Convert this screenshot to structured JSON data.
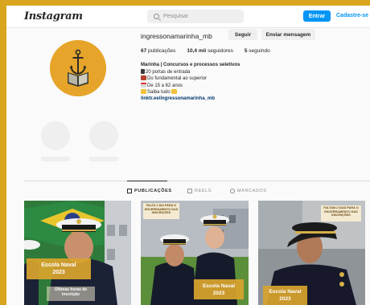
{
  "header": {
    "logo": "Instagram",
    "search_placeholder": "Pesquisar",
    "login_label": "Entrar",
    "signup_label": "Cadastre-se"
  },
  "profile": {
    "username": "ingressonamarinha_mb",
    "follow_label": "Seguir",
    "message_label": "Enviar mensagem",
    "stats": {
      "posts_count": "67",
      "posts_label": "publicações",
      "followers_count": "10,4 mil",
      "followers_label": "seguidores",
      "following_count": "5",
      "following_label": "seguindo"
    },
    "bio": {
      "name": "Marinha | Concursos e processos seletivos",
      "line1": "20 portas de entrada",
      "line2": "Do fundamental ao superior",
      "line3": "De 15 a 62 anos",
      "line4": "Saiba tudo",
      "link": "linktr.ee/ingressonamarinha_mb"
    }
  },
  "tabs": [
    {
      "label": "PUBLICAÇÕES",
      "active": true
    },
    {
      "label": "REELS",
      "active": false
    },
    {
      "label": "MARCADOS",
      "active": false
    }
  ],
  "posts": [
    {
      "caption_line1": "Escola Naval",
      "caption_line2": "2023",
      "badge": "Últimas horas de inscrição"
    },
    {
      "caption_line1": "Escola Naval",
      "caption_line2": "2023",
      "badge": "FALTA 1 DIA PARA O ENCERRAMENTO DAS INSCRIÇÕES"
    },
    {
      "caption_line1": "Escola Naval",
      "caption_line2": "2023",
      "badge": "FALTAM 2 DIAS PARA O ENCERRAMENTO DAS INSCRIÇÕES"
    }
  ],
  "colors": {
    "background_border": "#d9a51f",
    "accent_blue": "#0095f6",
    "caption_gold": "#d8a42d"
  }
}
